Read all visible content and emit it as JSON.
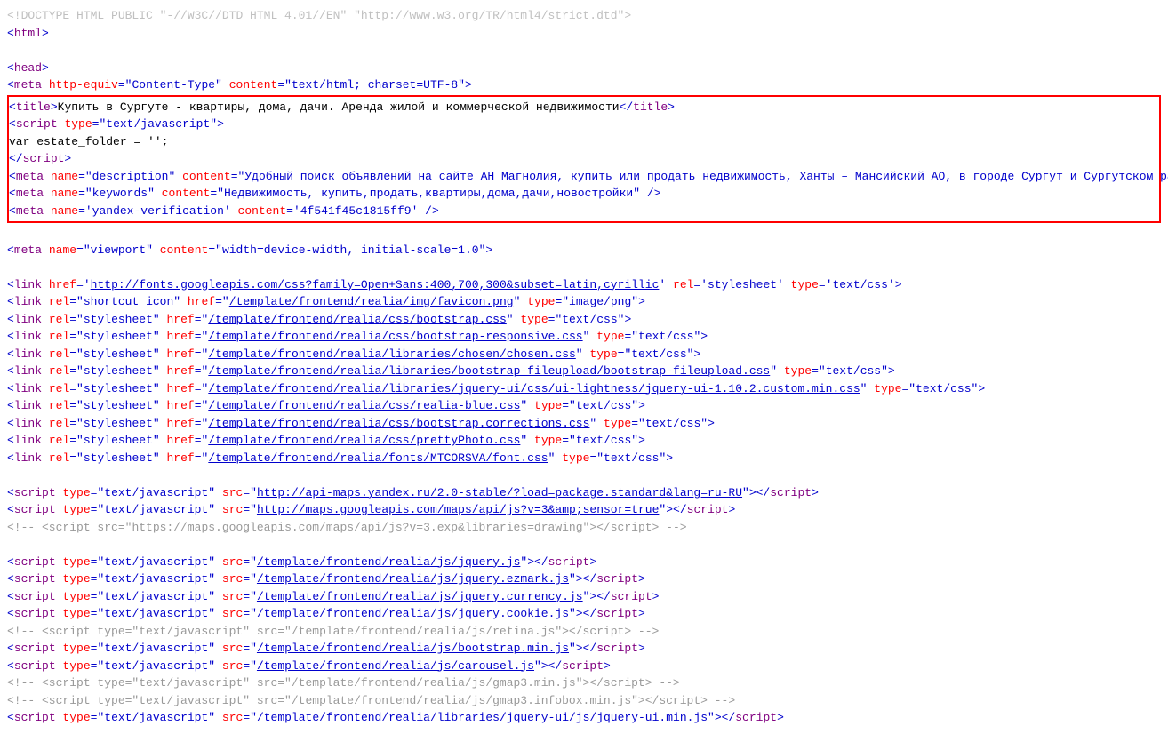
{
  "doctype": "<!DOCTYPE HTML PUBLIC \"-//W3C//DTD HTML 4.01//EN\" \"http://www.w3.org/TR/html4/strict.dtd\">",
  "meta_content_type": "text/html; charset=UTF-8",
  "title_text": "Купить в Сургуте - квартиры, дома, дачи. Аренда жилой и коммерческой недвижимости",
  "script_type": "text/javascript",
  "estate_line": "var estate_folder = '';",
  "meta_description": "Удобный поиск объявлений на сайте АН Магнолия, купить или продать недвижимость, Ханты – Мансийский АО, в городе Сургут и Сургутском районе.",
  "meta_keywords": "Недвижимость, купить,продать,квартиры,дома,дачи,новостройки",
  "yandex_verification": "4f541f45c1815ff9",
  "meta_viewport": "width=device-width, initial-scale=1.0",
  "fonts_url": "http://fonts.googleapis.com/css?family=Open+Sans:400,700,300&subset=latin,cyrillic",
  "favicon_url": "/template/frontend/realia/img/favicon.png",
  "css_urls": [
    "/template/frontend/realia/css/bootstrap.css",
    "/template/frontend/realia/css/bootstrap-responsive.css",
    "/template/frontend/realia/libraries/chosen/chosen.css",
    "/template/frontend/realia/libraries/bootstrap-fileupload/bootstrap-fileupload.css",
    "/template/frontend/realia/libraries/jquery-ui/css/ui-lightness/jquery-ui-1.10.2.custom.min.css",
    "/template/frontend/realia/css/realia-blue.css",
    "/template/frontend/realia/css/bootstrap.corrections.css",
    "/template/frontend/realia/css/prettyPhoto.css",
    "/template/frontend/realia/fonts/MTCORSVA/font.css"
  ],
  "yandex_maps_url": "http://api-maps.yandex.ru/2.0-stable/?load=package.standard&lang=ru-RU",
  "google_maps_url": "http://maps.googleapis.com/maps/api/js?v=3&amp;sensor=true",
  "google_maps_comment": "https://maps.googleapis.com/maps/api/js?v=3.exp&libraries=drawing",
  "js_urls": [
    "/template/frontend/realia/js/jquery.js",
    "/template/frontend/realia/js/jquery.ezmark.js",
    "/template/frontend/realia/js/jquery.currency.js",
    "/template/frontend/realia/js/jquery.cookie.js"
  ],
  "retina_comment": "/template/frontend/realia/js/retina.js",
  "bootstrap_js": "/template/frontend/realia/js/bootstrap.min.js",
  "carousel_js": "/template/frontend/realia/js/carousel.js",
  "gmap3_comment": "/template/frontend/realia/js/gmap3.min.js",
  "gmap3_infobox_comment": "/template/frontend/realia/js/gmap3.infobox.min.js",
  "jqueryui_js": "/template/frontend/realia/libraries/jquery-ui/js/jquery-ui.min.js"
}
